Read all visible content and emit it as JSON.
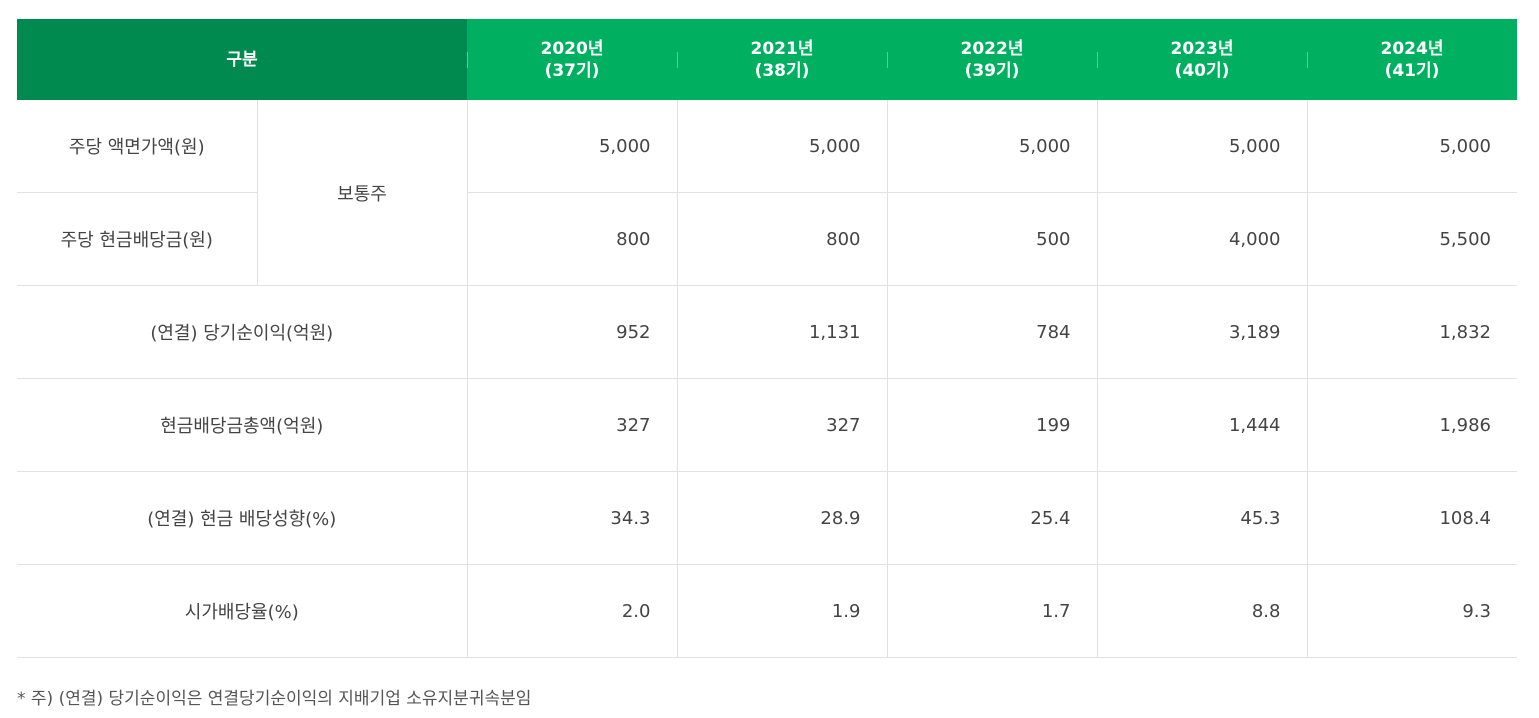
{
  "table": {
    "header": {
      "label": "구분",
      "years": [
        {
          "year": "2020년",
          "period": "(37기)"
        },
        {
          "year": "2021년",
          "period": "(38기)"
        },
        {
          "year": "2022년",
          "period": "(39기)"
        },
        {
          "year": "2023년",
          "period": "(40기)"
        },
        {
          "year": "2024년",
          "period": "(41기)"
        }
      ]
    },
    "share_type": "보통주",
    "rows": [
      {
        "label": "주당 액면가액(원)",
        "values": [
          "5,000",
          "5,000",
          "5,000",
          "5,000",
          "5,000"
        ]
      },
      {
        "label": "주당 현금배당금(원)",
        "values": [
          "800",
          "800",
          "500",
          "4,000",
          "5,500"
        ]
      },
      {
        "label": "(연결) 당기순이익(억원)",
        "values": [
          "952",
          "1,131",
          "784",
          "3,189",
          "1,832"
        ]
      },
      {
        "label": "현금배당금총액(억원)",
        "values": [
          "327",
          "327",
          "199",
          "1,444",
          "1,986"
        ]
      },
      {
        "label": "(연결) 현금 배당성향(%)",
        "values": [
          "34.3",
          "28.9",
          "25.4",
          "45.3",
          "108.4"
        ]
      },
      {
        "label": "시가배당율(%)",
        "values": [
          "2.0",
          "1.9",
          "1.7",
          "8.8",
          "9.3"
        ]
      }
    ]
  },
  "footnote": "* 주) (연결) 당기순이익은 연결당기순이익의 지배기업 소유지분귀속분임",
  "colors": {
    "header_label_bg": "#008a4f",
    "header_year_bg": "#00b060",
    "border": "#e2e2e2",
    "text": "#444444"
  }
}
